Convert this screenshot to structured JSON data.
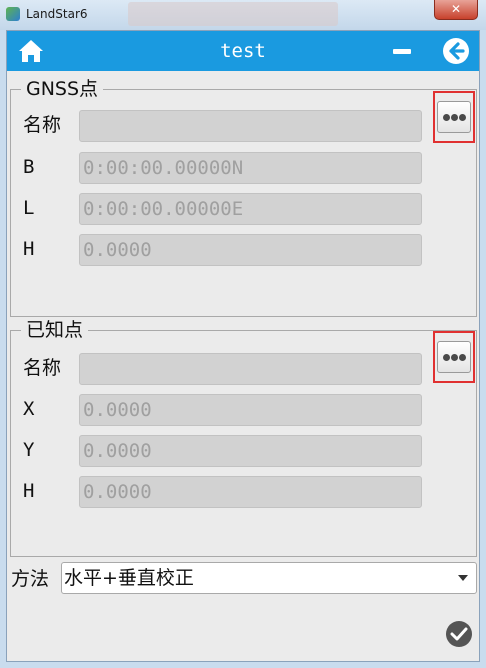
{
  "window": {
    "title": "LandStar6",
    "close_glyph": "✕"
  },
  "appbar": {
    "title": "test",
    "home_icon": "home-icon",
    "minimize_icon": "minus-icon",
    "back_icon": "arrow-left-circle-icon"
  },
  "gnss_group": {
    "title": "GNSS点",
    "rows": [
      {
        "label": "名称",
        "value": ""
      },
      {
        "label": "B",
        "value": "0:00:00.00000N"
      },
      {
        "label": "L",
        "value": "0:00:00.00000E"
      },
      {
        "label": "H",
        "value": "0.0000"
      }
    ],
    "pick_icon": "more-dots-icon"
  },
  "known_group": {
    "title": "已知点",
    "rows": [
      {
        "label": "名称",
        "value": ""
      },
      {
        "label": "X",
        "value": "0.0000"
      },
      {
        "label": "Y",
        "value": "0.0000"
      },
      {
        "label": "H",
        "value": "0.0000"
      }
    ],
    "pick_icon": "more-dots-icon"
  },
  "method": {
    "label": "方法",
    "selected": "水平+垂直校正"
  },
  "colors": {
    "accent": "#1a9ae0",
    "highlight_box": "#e03030",
    "panel_bg": "#ebebeb"
  }
}
